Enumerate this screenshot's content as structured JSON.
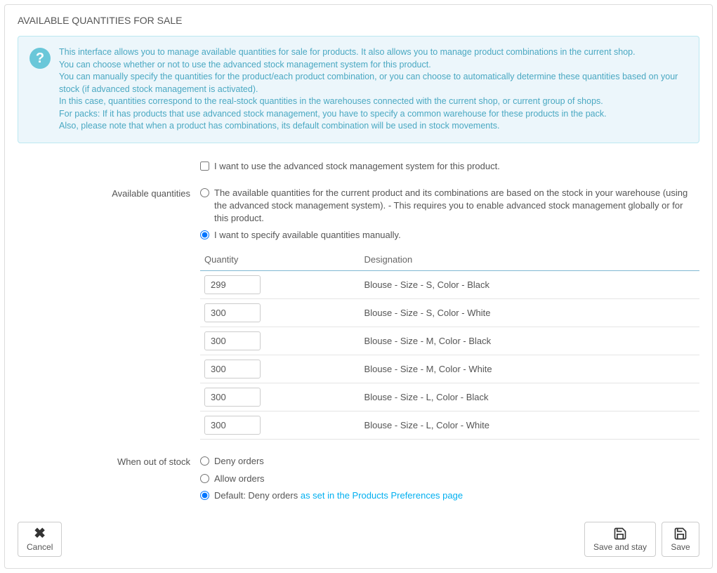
{
  "panel": {
    "title": "AVAILABLE QUANTITIES FOR SALE"
  },
  "info": {
    "lines": [
      "This interface allows you to manage available quantities for sale for products. It also allows you to manage product combinations in the current shop.",
      "You can choose whether or not to use the advanced stock management system for this product.",
      "You can manually specify the quantities for the product/each product combination, or you can choose to automatically determine these quantities based on your stock (if advanced stock management is activated).",
      "In this case, quantities correspond to the real-stock quantities in the warehouses connected with the current shop, or current group of shops.",
      "For packs: If it has products that use advanced stock management, you have to specify a common warehouse for these products in the pack.",
      "Also, please note that when a product has combinations, its default combination will be used in stock movements."
    ]
  },
  "checkbox": {
    "advanced_label": "I want to use the advanced stock management system for this product."
  },
  "available_quantities": {
    "label": "Available quantities",
    "option_warehouse": "The available quantities for the current product and its combinations are based on the stock in your warehouse (using the advanced stock management system).  - This requires you to enable advanced stock management globally or for this product.",
    "option_manual": "I want to specify available quantities manually."
  },
  "table": {
    "col_quantity": "Quantity",
    "col_designation": "Designation",
    "rows": [
      {
        "qty": "299",
        "designation": "Blouse - Size - S, Color - Black"
      },
      {
        "qty": "300",
        "designation": "Blouse - Size - S, Color - White"
      },
      {
        "qty": "300",
        "designation": "Blouse - Size - M, Color - Black"
      },
      {
        "qty": "300",
        "designation": "Blouse - Size - M, Color - White"
      },
      {
        "qty": "300",
        "designation": "Blouse - Size - L, Color - Black"
      },
      {
        "qty": "300",
        "designation": "Blouse - Size - L, Color - White"
      }
    ]
  },
  "out_of_stock": {
    "label": "When out of stock",
    "option_deny": "Deny orders",
    "option_allow": "Allow orders",
    "option_default_prefix": "Default: Deny orders ",
    "option_default_link": "as set in the Products Preferences page"
  },
  "buttons": {
    "cancel": "Cancel",
    "save_and_stay": "Save and stay",
    "save": "Save"
  }
}
